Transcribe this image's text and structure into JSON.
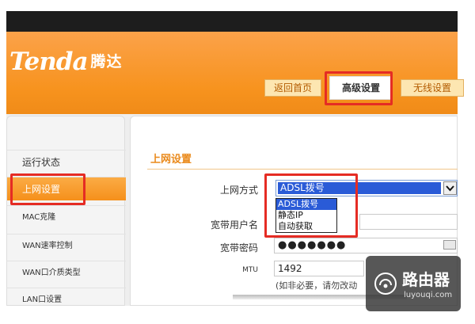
{
  "brand": {
    "logo_text": "Tenda",
    "logo_cn": "腾达"
  },
  "tabs": [
    {
      "label": "返回首页"
    },
    {
      "label": "高级设置",
      "active": true
    },
    {
      "label": "无线设置"
    }
  ],
  "sidebar": {
    "items": [
      {
        "label": "运行状态"
      },
      {
        "label": "上网设置",
        "active": true
      },
      {
        "label": "MAC克隆"
      },
      {
        "label": "WAN速率控制"
      },
      {
        "label": "WAN口介质类型"
      },
      {
        "label": "LAN口设置"
      }
    ]
  },
  "section": {
    "title": "上网设置"
  },
  "form": {
    "mode": {
      "label": "上网方式",
      "value": "ADSL拨号",
      "options": [
        "ADSL拨号",
        "静态IP",
        "自动获取"
      ]
    },
    "username": {
      "label": "宽带用户名",
      "value": ""
    },
    "password": {
      "label": "宽带密码",
      "value": "●●●●●●●"
    },
    "mtu": {
      "label": "MTU",
      "value": "1492",
      "note": "(如非必要，请勿改动"
    }
  },
  "watermark": {
    "title": "路由器",
    "site": "luyouqi.com"
  },
  "colors": {
    "accent": "#f7931e",
    "highlight": "#e52c24",
    "select": "#2a5bd7"
  }
}
